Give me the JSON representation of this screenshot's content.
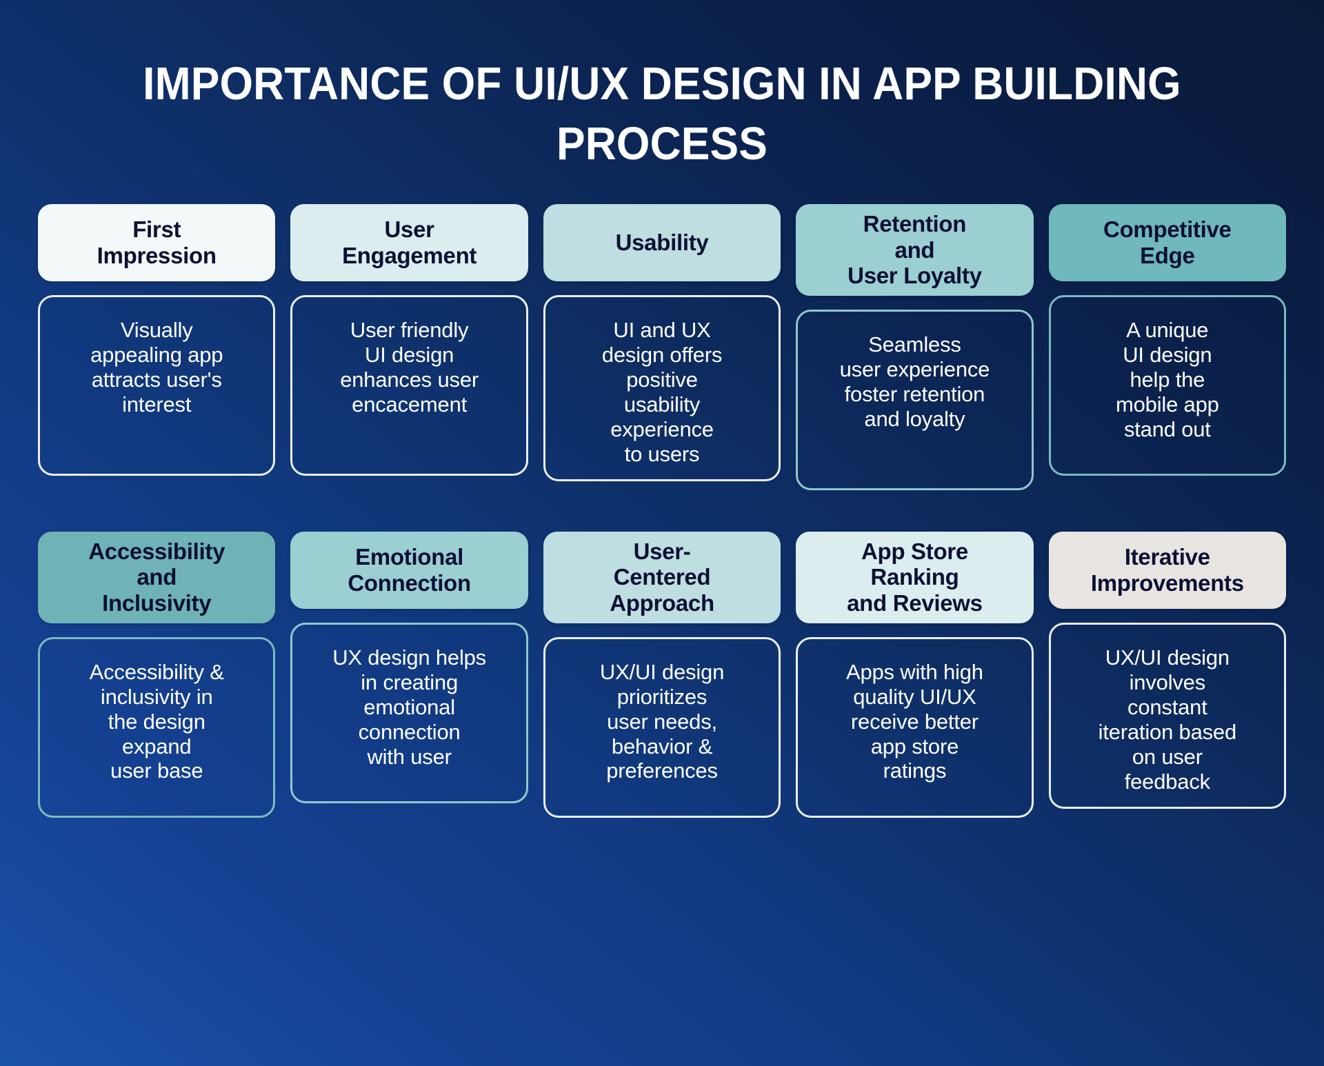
{
  "title": "IMPORTANCE OF UI/UX DESIGN IN APP BUILDING PROCESS",
  "theme": {
    "background_gradient_from": "#154193",
    "background_gradient_to": "#0a1d42",
    "header_text_color": "#0d1033",
    "body_text_color": "#FFFFFF",
    "body_border_color": "#FFFFFF"
  },
  "rows": [
    {
      "cards": [
        {
          "heading": "First\nImpression",
          "body": "Visually\nappealing app\nattracts user's\ninterest",
          "heading_bg": "#F2F9F8",
          "border_style": "white"
        },
        {
          "heading": "User\nEngagement",
          "body": "User friendly\nUI design\nenhances user\nencacement",
          "heading_bg": "#DCEDEF",
          "border_style": "white"
        },
        {
          "heading": "Usability",
          "body": "UI and UX\ndesign offers\npositive\nusability\nexperience\nto users",
          "heading_bg": "#BEDEE1",
          "border_style": "white"
        },
        {
          "heading": "Retention\nand\nUser Loyalty",
          "body": "Seamless\nuser experience\nfoster retention\nand loyalty",
          "heading_bg": "#9BCFD2",
          "border_style": "teal"
        },
        {
          "heading": "Competitive\nEdge",
          "body": "A unique\nUI design\nhelp the\nmobile app\nstand out",
          "heading_bg": "#6FB8BC",
          "border_style": "teal-strong"
        }
      ]
    },
    {
      "cards": [
        {
          "heading": "Accessibility\nand\nInclusivity",
          "body": "Accessibility &\ninclusivity in\nthe design\nexpand\nuser base",
          "heading_bg": "#6FB3B6",
          "border_style": "teal-strong"
        },
        {
          "heading": "Emotional\nConnection",
          "body": "UX design helps\nin creating\nemotional\nconnection\nwith user",
          "heading_bg": "#9BCFD2",
          "border_style": "teal"
        },
        {
          "heading": "User-\nCentered\nApproach",
          "body": "UX/UI design\nprioritizes\nuser needs,\nbehavior &\npreferences",
          "heading_bg": "#BEDEE1",
          "border_style": "white"
        },
        {
          "heading": "App Store\nRanking\nand Reviews",
          "body": "Apps with high\nquality UI/UX\nreceive better\napp store\nratings",
          "heading_bg": "#DCEDEF",
          "border_style": "white"
        },
        {
          "heading": "Iterative\nImprovements",
          "body": "UX/UI design\ninvolves\nconstant\niteration based\non user\nfeedback",
          "heading_bg": "#E8E4E2",
          "border_style": "white"
        }
      ]
    }
  ]
}
